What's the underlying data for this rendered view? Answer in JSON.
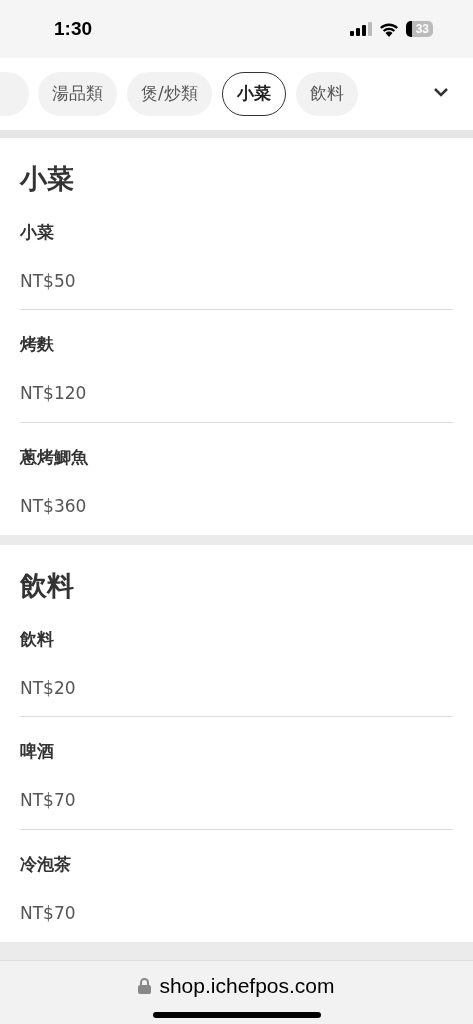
{
  "status_bar": {
    "time": "1:30",
    "battery": "33"
  },
  "tabs": [
    {
      "label": "湯品類",
      "selected": false
    },
    {
      "label": "煲/炒類",
      "selected": false
    },
    {
      "label": "小菜",
      "selected": true
    },
    {
      "label": "飲料",
      "selected": false
    }
  ],
  "sections": [
    {
      "title": "小菜",
      "items": [
        {
          "name": "小菜",
          "price": "NT$50"
        },
        {
          "name": "烤麩",
          "price": "NT$120"
        },
        {
          "name": "蔥烤鯽魚",
          "price": "NT$360"
        }
      ]
    },
    {
      "title": "飲料",
      "items": [
        {
          "name": "飲料",
          "price": "NT$20"
        },
        {
          "name": "啤酒",
          "price": "NT$70"
        },
        {
          "name": "冷泡茶",
          "price": "NT$70"
        }
      ]
    }
  ],
  "address_bar": {
    "url": "shop.ichefpos.com"
  }
}
